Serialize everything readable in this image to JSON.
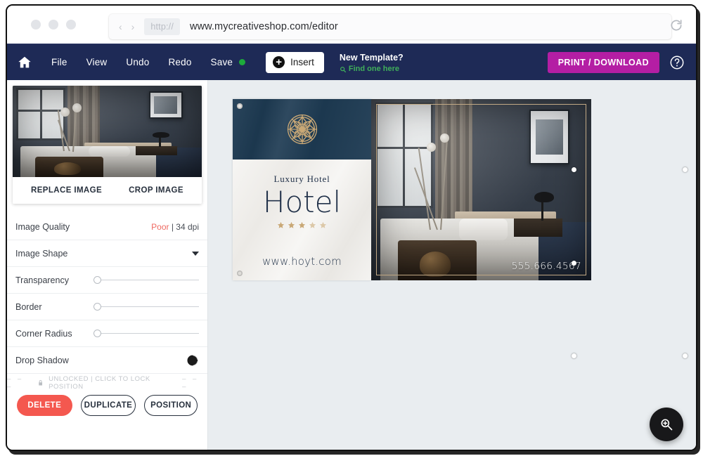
{
  "browser": {
    "url": "www.mycreativeshop.com/editor",
    "http_chip": "http://",
    "back_arrow": "‹",
    "forward_arrow": "›"
  },
  "navbar": {
    "home_icon": "home-icon",
    "menu": [
      {
        "label": "File"
      },
      {
        "label": "View"
      },
      {
        "label": "Undo"
      },
      {
        "label": "Redo"
      }
    ],
    "save_label": "Save",
    "save_status_color": "#1dab3b",
    "insert_label": "Insert",
    "new_template_title": "New Template?",
    "new_template_link": "Find one here",
    "print_download_label": "PRINT / DOWNLOAD",
    "print_download_color": "#b41ea4",
    "help_icon": "question-mark-icon",
    "background_color": "#1e2a56"
  },
  "sidebar": {
    "preview": {
      "replace_label": "REPLACE IMAGE",
      "crop_label": "CROP IMAGE"
    },
    "rows": [
      {
        "label": "Image Quality",
        "value_warning": "Poor",
        "value_rest": " | 34 dpi"
      },
      {
        "label": "Image Shape"
      },
      {
        "label": "Transparency"
      },
      {
        "label": "Border"
      },
      {
        "label": "Corner Radius"
      },
      {
        "label": "Drop Shadow"
      }
    ],
    "lock": {
      "dashes_left": "–  –  –",
      "text": "UNLOCKED | CLICK TO LOCK POSITION",
      "dashes_right": "–  –  –"
    },
    "buttons": {
      "delete": "DELETE",
      "duplicate": "DUPLICATE",
      "position": "POSITION"
    },
    "colors": {
      "delete_bg": "#f4584f",
      "outline": "#27303d",
      "quality_warning": "#ef6a62"
    }
  },
  "canvas": {
    "background_color": "#e9edf0",
    "design": {
      "banner": {
        "top_color": "#1d3a52",
        "medallion_color": "#c9a876",
        "luxury_label": "Luxury Hotel",
        "hotel_word": "Hotel",
        "stars_count": 5,
        "star_color": "#c9a876",
        "website": "www.hoyt.com"
      },
      "photo": {
        "phone_number": "555.666.4567",
        "frame_color": "#c2a985"
      }
    },
    "zoom_fab_icon": "zoom-in-icon"
  }
}
